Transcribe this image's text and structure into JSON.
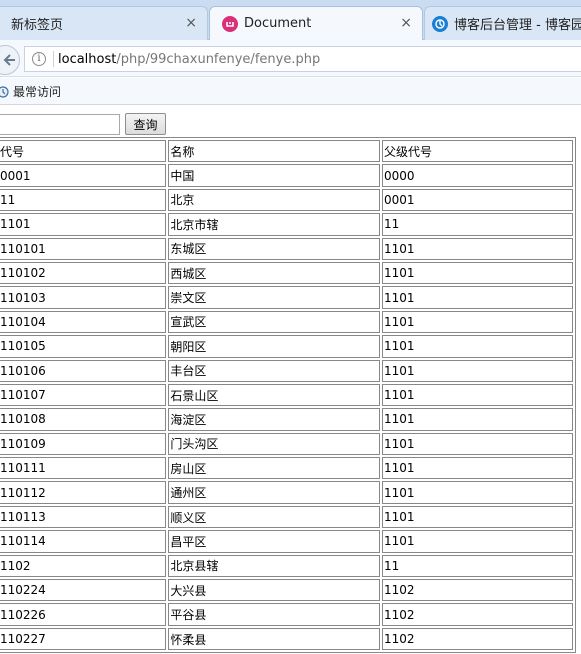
{
  "browser": {
    "tabs": [
      {
        "title": "新标签页",
        "close": "×"
      },
      {
        "title": "Document",
        "close": "×"
      },
      {
        "title": "博客后台管理 - 博客园"
      }
    ],
    "url": {
      "host": "localhost",
      "path": "/php/99chaxunfenye/fenye.php"
    },
    "info_glyph": "i",
    "bookmark": "最常访问",
    "colors": {
      "tabstrip": "#c9dcf1",
      "active_tab": "#f5f8fc",
      "document_favicon": "#d9307a",
      "blog_favicon": "#1a7fd4"
    }
  },
  "page": {
    "search": {
      "value": "",
      "button": "查询"
    },
    "table": {
      "headers": [
        "代号",
        "名称",
        "父级代号"
      ],
      "rows": [
        [
          "0001",
          "中国",
          "0000"
        ],
        [
          "11",
          "北京",
          "0001"
        ],
        [
          "1101",
          "北京市辖",
          "11"
        ],
        [
          "110101",
          "东城区",
          "1101"
        ],
        [
          "110102",
          "西城区",
          "1101"
        ],
        [
          "110103",
          "崇文区",
          "1101"
        ],
        [
          "110104",
          "宣武区",
          "1101"
        ],
        [
          "110105",
          "朝阳区",
          "1101"
        ],
        [
          "110106",
          "丰台区",
          "1101"
        ],
        [
          "110107",
          "石景山区",
          "1101"
        ],
        [
          "110108",
          "海淀区",
          "1101"
        ],
        [
          "110109",
          "门头沟区",
          "1101"
        ],
        [
          "110111",
          "房山区",
          "1101"
        ],
        [
          "110112",
          "通州区",
          "1101"
        ],
        [
          "110113",
          "顺义区",
          "1101"
        ],
        [
          "110114",
          "昌平区",
          "1101"
        ],
        [
          "1102",
          "北京县辖",
          "11"
        ],
        [
          "110224",
          "大兴县",
          "1102"
        ],
        [
          "110226",
          "平谷县",
          "1102"
        ],
        [
          "110227",
          "怀柔县",
          "1102"
        ]
      ]
    }
  }
}
